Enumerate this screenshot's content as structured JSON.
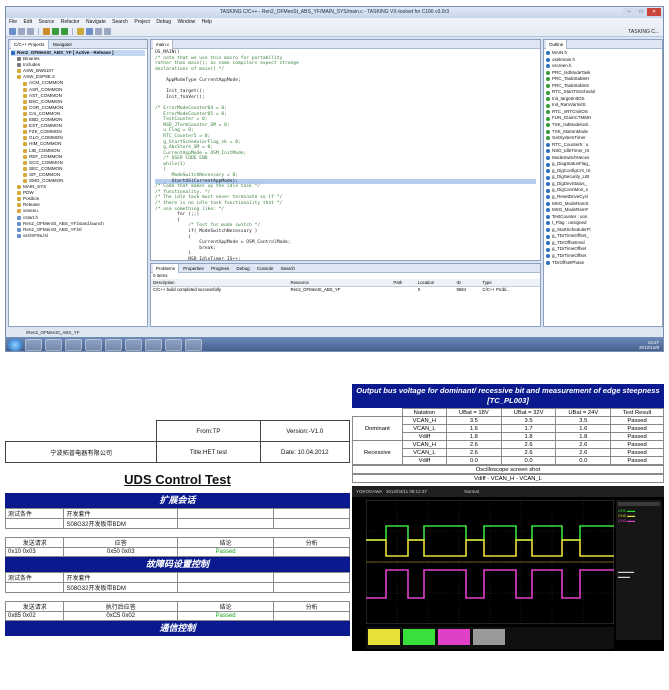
{
  "ide": {
    "window_title": "TASKING C/C++ - Ren2_OFMenSt_ABS_YF/MAIN_SYS/main.c - TASKING VX-toolset for C166 v3.0r3",
    "menu": [
      "File",
      "Edit",
      "Source",
      "Refactor",
      "Navigate",
      "Search",
      "Project",
      "Debug",
      "Window",
      "Help"
    ],
    "perspective": "TASKING C...",
    "left_tabs": [
      "C/C++ Projects",
      "Navigator"
    ],
    "project_tree": [
      {
        "label": "Ren2_OFMenSt_ABS_YF [ Active - Release ]",
        "level": 0,
        "highlight": true,
        "icon": "project-icon"
      },
      {
        "label": "Binaries",
        "level": 1,
        "icon": "binary-icon"
      },
      {
        "label": "Includes",
        "level": 1,
        "icon": "include-icon"
      },
      {
        "label": "ASW_BW6107",
        "level": 1,
        "icon": "folder-icon"
      },
      {
        "label": "ASW_ESP8E.2",
        "level": 1,
        "icon": "folder-icon"
      },
      {
        "label": "ACM_COMMON",
        "level": 2,
        "icon": "folder-icon"
      },
      {
        "label": "ASR_COMMON",
        "level": 2,
        "icon": "folder-icon"
      },
      {
        "label": "AST_COMMON",
        "level": 2,
        "icon": "folder-icon"
      },
      {
        "label": "BSC_COMMON",
        "level": 2,
        "icon": "folder-icon"
      },
      {
        "label": "COR_COMMON",
        "level": 2,
        "icon": "folder-icon"
      },
      {
        "label": "Crs_COMMON",
        "level": 2,
        "icon": "folder-icon"
      },
      {
        "label": "EBD_COMMON",
        "level": 2,
        "icon": "folder-icon"
      },
      {
        "label": "EST_COMMON",
        "level": 2,
        "icon": "folder-icon"
      },
      {
        "label": "FZK_COMMON",
        "level": 2,
        "icon": "folder-icon"
      },
      {
        "label": "GLO_COMMON",
        "level": 2,
        "icon": "folder-icon"
      },
      {
        "label": "HIM_COMMON",
        "level": 2,
        "icon": "folder-icon"
      },
      {
        "label": "LIB_COMMON",
        "level": 2,
        "icon": "folder-icon"
      },
      {
        "label": "REF_COMMON",
        "level": 2,
        "icon": "folder-icon"
      },
      {
        "label": "SCG_COMMON",
        "level": 2,
        "icon": "folder-icon"
      },
      {
        "label": "SEC_COMMON",
        "level": 2,
        "icon": "folder-icon"
      },
      {
        "label": "SIF_COMMON",
        "level": 2,
        "icon": "folder-icon"
      },
      {
        "label": "SMO_COMMON",
        "level": 2,
        "icon": "folder-icon"
      },
      {
        "label": "MAIN_SYS",
        "level": 1,
        "icon": "folder-icon"
      },
      {
        "label": "PDW",
        "level": 1,
        "icon": "folder-icon"
      },
      {
        "label": "Position",
        "level": 1,
        "icon": "folder-icon"
      },
      {
        "label": "Release",
        "level": 1,
        "icon": "folder-icon"
      },
      {
        "label": "vesenu",
        "level": 1,
        "icon": "folder-icon"
      },
      {
        "label": "cstart.h",
        "level": 1,
        "icon": "file-icon"
      },
      {
        "label": "Ren2_OFMenSt_ABS_YF.board.launch",
        "level": 1,
        "icon": "file-icon"
      },
      {
        "label": "Ren2_OFMenSt_ABS_YF.lsl",
        "level": 1,
        "icon": "file-icon"
      },
      {
        "label": "vsOSF9a.lsl",
        "level": 1,
        "icon": "file-icon"
      }
    ],
    "editor_tab": "main.c",
    "code_lines": [
      {
        "text": "OS_MAIN()",
        "type": "code"
      },
      {
        "text": "/* note that we use this macro for portability",
        "type": "comment"
      },
      {
        "text": "rather than main(); as some compilers expect strange",
        "type": "comment"
      },
      {
        "text": "declarations of main() */",
        "type": "comment"
      },
      {
        "text": "",
        "type": "code"
      },
      {
        "text": "    AppModeType CurrentAppMode;",
        "type": "code"
      },
      {
        "text": "",
        "type": "code"
      },
      {
        "text": "    Init_target();",
        "type": "code"
      },
      {
        "text": "    Init_fnaVer();",
        "type": "code"
      },
      {
        "text": "",
        "type": "code"
      },
      {
        "text": "/* ErrorModeCounter04 = 0;",
        "type": "comment"
      },
      {
        "text": "   ErrorModeCounter05 = 0;",
        "type": "comment"
      },
      {
        "text": "   TestCounter = 0;",
        "type": "comment"
      },
      {
        "text": "   NSD_JTermCounter_SM = 0;",
        "type": "comment"
      },
      {
        "text": "   u_Flag = 0;",
        "type": "comment"
      },
      {
        "text": "   RTC_Counter5 = 0;",
        "type": "comment"
      },
      {
        "text": "   g_StartSchedulerFlag_sb = 0;",
        "type": "comment"
      },
      {
        "text": "   g_AbcStore_SM = 0;",
        "type": "comment"
      },
      {
        "text": "   CurrentAppMode = OSM_InitMode;",
        "type": "comment"
      },
      {
        "text": "   /* USER CODE END",
        "type": "comment"
      },
      {
        "text": "   while(1)",
        "type": "comment"
      },
      {
        "text": "   {",
        "type": "comment"
      },
      {
        "text": "      ModeSwitchNecessary = 0;",
        "type": "comment"
      },
      {
        "text": "      StartOS(CurrentAppMode);",
        "type": "selected"
      },
      {
        "text": "/* Code that makes up the idle task */",
        "type": "comment"
      },
      {
        "text": "/* functionality. */",
        "type": "comment"
      },
      {
        "text": "/* The idle task must never terminate so if */",
        "type": "comment"
      },
      {
        "text": "/* there is no idle task functionality that */",
        "type": "comment"
      },
      {
        "text": "/* use something like: */",
        "type": "comment"
      },
      {
        "text": "        for (;;)",
        "type": "code"
      },
      {
        "text": "        {",
        "type": "code"
      },
      {
        "text": "            /* Test for mode switch */",
        "type": "comment"
      },
      {
        "text": "            if( ModeSwitchNecessary )",
        "type": "code"
      },
      {
        "text": "            {",
        "type": "code"
      },
      {
        "text": "                CurrentAppMode = OSM_ControlMode;",
        "type": "code"
      },
      {
        "text": "                break;",
        "type": "code"
      },
      {
        "text": "            }",
        "type": "code"
      },
      {
        "text": "            NSD_IdleTimer_IS++;",
        "type": "code"
      }
    ],
    "outline_tab": "Outline",
    "outline_items": [
      {
        "label": "MAIN.h",
        "color": "#2f6fc2"
      },
      {
        "label": "osekmain.h",
        "color": "#2f6fc2"
      },
      {
        "label": "vscreen.h",
        "color": "#2f6fc2"
      },
      {
        "label": "PRC_IsdModeTask",
        "color": "#3a9b3a"
      },
      {
        "label": "PRC_TaskStableH",
        "color": "#3a9b3a"
      },
      {
        "label": "PRC_TaskStableS",
        "color": "#3a9b3a"
      },
      {
        "label": "RTC_StartTSSchedul",
        "color": "#3a9b3a"
      },
      {
        "label": "Init_targetInitOS",
        "color": "#3a9b3a"
      },
      {
        "label": "Init_RamVarInitS",
        "color": "#3a9b3a"
      },
      {
        "label": "RTC_nRTCInitOS",
        "color": "#3a9b3a"
      },
      {
        "label": "FUN_IGainCTMMH",
        "color": "#3a9b3a"
      },
      {
        "label": "TSK_IsdModelock",
        "color": "#3a9b3a"
      },
      {
        "label": "TSK_MainInMode",
        "color": "#3a9b3a"
      },
      {
        "label": "GetSystemTimer",
        "color": "#3a9b3a"
      },
      {
        "label": "RTC_Counter5 : u",
        "color": "#2f6fc2"
      },
      {
        "label": "NSD_IdleTimer_IS",
        "color": "#2f6fc2"
      },
      {
        "label": "ModeSwitchNeces",
        "color": "#2f6fc2"
      },
      {
        "label": "g_DiagStatusFlag_",
        "color": "#2f6fc2"
      },
      {
        "label": "g_DigConfigCnt_IS",
        "color": "#2f6fc2"
      },
      {
        "label": "g_DigSecurity_LIB",
        "color": "#2f6fc2"
      },
      {
        "label": "g_DigDevStatus_",
        "color": "#2f6fc2"
      },
      {
        "label": "g_DigConnMon_s",
        "color": "#2f6fc2"
      },
      {
        "label": "g_ResetDriveCycl",
        "color": "#2f6fc2"
      },
      {
        "label": "MSG_ModeRamS",
        "color": "#2f6fc2"
      },
      {
        "label": "MSG_ModeRamF",
        "color": "#2f6fc2"
      },
      {
        "label": "TestCounter : uns",
        "color": "#2f6fc2"
      },
      {
        "label": "t_Flag : unsigned",
        "color": "#2f6fc2"
      },
      {
        "label": "g_StartSchedulerFl",
        "color": "#2f6fc2"
      },
      {
        "label": "g_TDrTimeOffset_",
        "color": "#2f6fc2"
      },
      {
        "label": "g_TDrOffsetHnd",
        "color": "#2f6fc2"
      },
      {
        "label": "g_TDrTimeOffset",
        "color": "#2f6fc2"
      },
      {
        "label": "g_TDrTimeOffset",
        "color": "#2f6fc2"
      },
      {
        "label": "TDrOffsetPhase",
        "color": "#2f6fc2"
      }
    ],
    "bottom_tabs": [
      "Problems",
      "Properties",
      "Progress",
      "Debug",
      "Console",
      "Search"
    ],
    "problems_summary": "0 items",
    "problems_columns": [
      "Description",
      "Resource",
      "Path",
      "Location",
      "ID",
      "Type"
    ],
    "problems_rows": [
      [
        "C/C++ build completed successfully",
        "Ren2_OFMenSt_ABS_YF",
        "",
        "0",
        "9584",
        "C/C++ Probl..."
      ]
    ],
    "status_text": "/Ren2_OFMenSt_ABS_YF",
    "clock_time": "14:27",
    "clock_date": "2012/12/8"
  },
  "doc": {
    "header": {
      "from": "From:TP",
      "version": "Version:-V1.0",
      "company": "宁波拓普电器有限公司",
      "title": "Title:HET test",
      "date": "Date: 10.04.2012"
    },
    "main_title": "UDS Control Test",
    "sections": [
      {
        "band": "扩展会话",
        "cond_label": "测试条件",
        "kit_label": "开发套件",
        "kit_value": "S08G32开发板带BDM",
        "cols": [
          "发送请求",
          "应答",
          "结论",
          "分析"
        ],
        "row": [
          "0x10 0x03",
          "0x50 0x03",
          "Passed",
          ""
        ]
      },
      {
        "band": "故障码设置控制",
        "cond_label": "测试条件",
        "kit_label": "开发套件",
        "kit_value": "S08G32开发板带BDM",
        "cols": [
          "发送请求",
          "执行后应答",
          "结论",
          "分析"
        ],
        "row": [
          "0x85 0x02",
          "0xC5 0x02",
          "Passed",
          ""
        ]
      }
    ],
    "last_band": "通信控制"
  },
  "measure": {
    "title": "Output bus voltage for dominant/ recessive bit and measurement of edge steepness [TC_PL003]",
    "columns": [
      "Natation",
      "UBat = 18V",
      "UBat = 32V",
      "UBat = 24V",
      "Test Result"
    ],
    "groups": [
      {
        "name": "Dominant",
        "rows": [
          [
            "VCAN_H",
            "3.5",
            "3.5",
            "3.5",
            "Passed"
          ],
          [
            "VCAN_L",
            "1.6",
            "1.7",
            "1.6",
            "Passed"
          ],
          [
            "Vdiff",
            "1.8",
            "1.8",
            "1.8",
            "Passed"
          ]
        ]
      },
      {
        "name": "Recessive",
        "rows": [
          [
            "VCAN_H",
            "2.6",
            "2.6",
            "2.6",
            "Passed"
          ],
          [
            "VCAN_L",
            "2.6",
            "2.6",
            "2.6",
            "Passed"
          ],
          [
            "Vdiff",
            "0.0",
            "0.0",
            "0.0",
            "Passed"
          ]
        ]
      }
    ],
    "scope_caption": "Oscilloscope screen shot",
    "scope_subcaption": "Vdiff - VCAN_H - VCAN_L",
    "scope_brand": "YOKOGAWA",
    "scope_header_date": "2012/04/11 09:12:37",
    "scope_mode": "Normal"
  }
}
